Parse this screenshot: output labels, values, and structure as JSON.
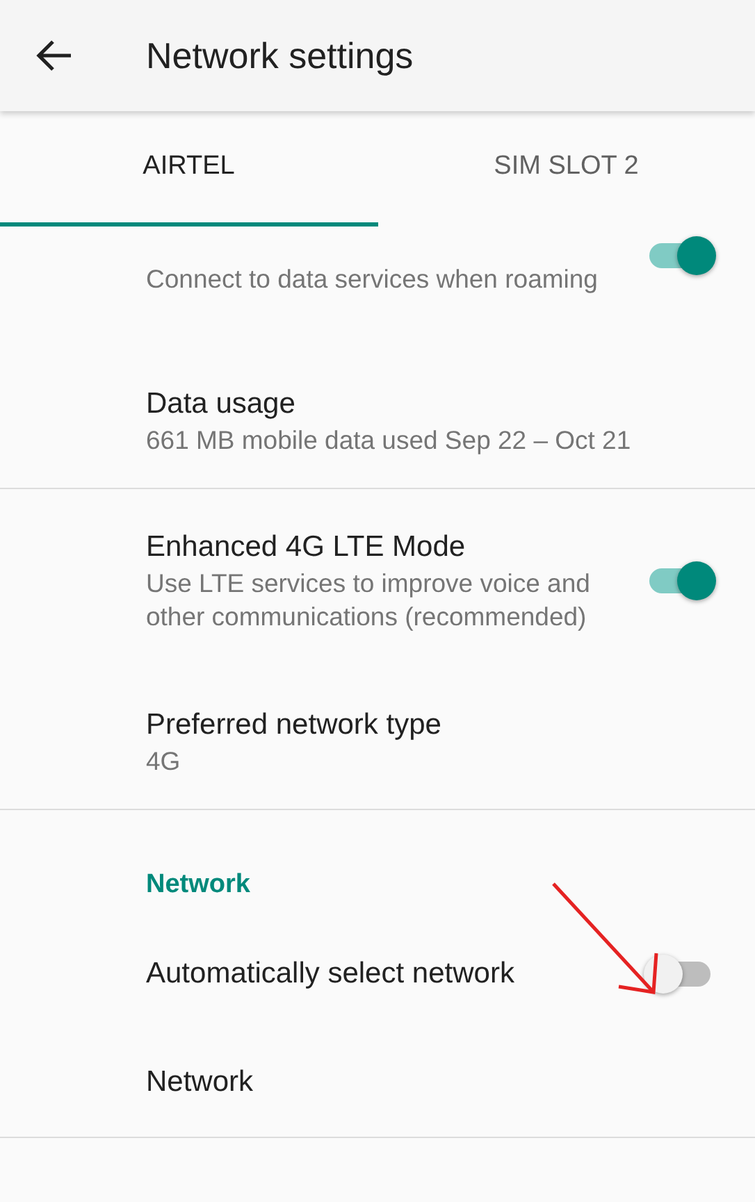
{
  "app_bar": {
    "title": "Network settings"
  },
  "tabs": [
    {
      "label": "AIRTEL",
      "selected": true
    },
    {
      "label": "SIM SLOT 2",
      "selected": false
    }
  ],
  "sections": [
    {
      "items": [
        {
          "kind": "switch",
          "summary": "Connect to data services when roaming",
          "on": true
        },
        {
          "kind": "text",
          "title": "Data usage",
          "summary": "661 MB mobile data used Sep 22 – Oct 21"
        }
      ]
    },
    {
      "items": [
        {
          "kind": "switch",
          "title": "Enhanced 4G LTE Mode",
          "summary": "Use LTE services to improve voice and other communications (recommended)",
          "on": true
        },
        {
          "kind": "text",
          "title": "Preferred network type",
          "summary": "4G"
        }
      ]
    },
    {
      "header": "Network",
      "items": [
        {
          "kind": "switch",
          "title": "Automatically select network",
          "on": false
        },
        {
          "kind": "text",
          "title": "Network"
        }
      ]
    }
  ]
}
